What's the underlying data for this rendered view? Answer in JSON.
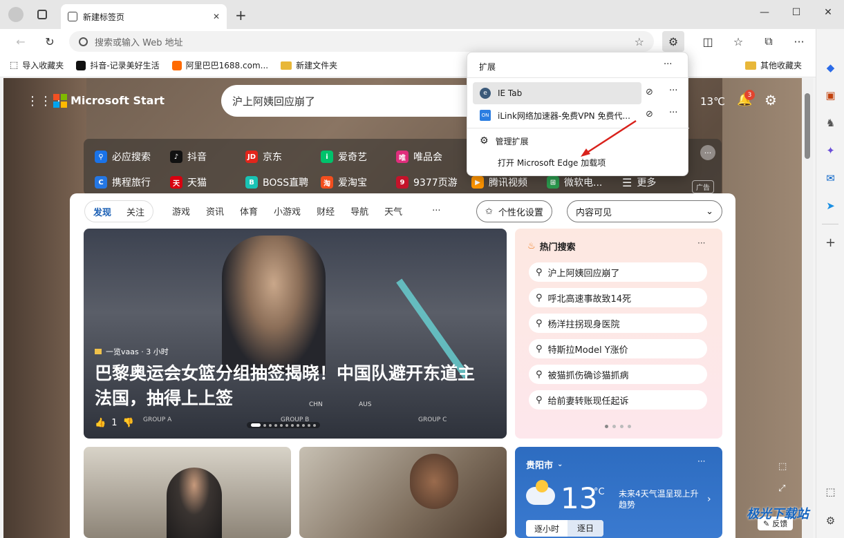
{
  "window": {
    "tab_title": "新建标签页",
    "new_tab": "+",
    "minimize": "—",
    "maximize": "☐",
    "close": "✕"
  },
  "toolbar": {
    "address_placeholder": "搜索或输入 Web 地址"
  },
  "bookmarks": [
    {
      "label": "导入收藏夹"
    },
    {
      "label": "抖音-记录美好生活"
    },
    {
      "label": "阿里巴巴1688.com..."
    },
    {
      "label": "新建文件夹"
    }
  ],
  "bookmarks_other": "其他收藏夹",
  "start": {
    "brand": "Microsoft Start",
    "search_text": "沪上阿姨回应崩了",
    "temperature": "13℃",
    "notifications": "3"
  },
  "quick_links_row1": [
    "必应搜索",
    "抖音",
    "京东",
    "爱奇艺",
    "唯品会"
  ],
  "quick_links_row2": [
    "携程旅行",
    "天猫",
    "BOSS直聘",
    "爱淘宝",
    "9377页游",
    "腾讯视频",
    "微软电...",
    "更多"
  ],
  "quick_links_ad": "广告",
  "feed_nav": {
    "tabs": [
      "发现",
      "关注",
      "游戏",
      "资讯",
      "体育",
      "小游戏",
      "财经",
      "导航",
      "天气"
    ],
    "more": "···",
    "personalize": "个性化设置",
    "visibility": "内容可见"
  },
  "hero": {
    "source": "一览vaas · 3 小时",
    "headline": "巴黎奥运会女篮分组抽签揭晓！中国队避开东道主法国，抽得上上签",
    "likes": "1",
    "groups": [
      "GROUP A",
      "GROUP B",
      "GROUP C"
    ],
    "teams": [
      "CHN",
      "AUS"
    ]
  },
  "hot": {
    "title": "热门搜索",
    "items": [
      "沪上阿姨回应崩了",
      "呼北高速事故致14死",
      "杨洋拄拐现身医院",
      "特斯拉Model Y涨价",
      "被猫抓伤确诊猫抓病",
      "给前妻转账现任起诉"
    ]
  },
  "weather": {
    "city": "贵阳市",
    "temp": "13",
    "unit": "°C",
    "forecast": "未来4天气温呈现上升趋势",
    "tab_hourly": "逐小时",
    "tab_daily": "逐日"
  },
  "feedback": "反馈",
  "popup": {
    "title": "扩展",
    "items": [
      {
        "label": "IE Tab"
      },
      {
        "label": "iLink网络加速器-免费VPN 免费代..."
      }
    ],
    "manage": "管理扩展",
    "open_addons": "打开 Microsoft Edge 加载项"
  },
  "watermark": "极光下载站"
}
